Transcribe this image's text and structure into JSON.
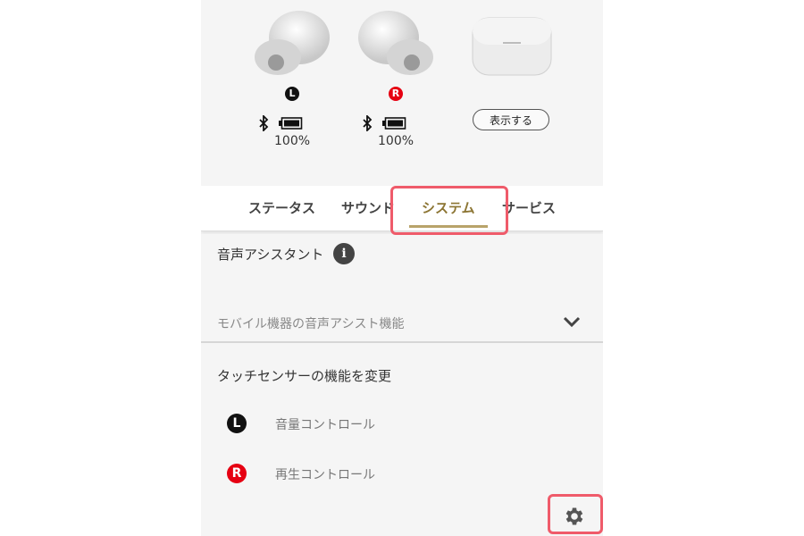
{
  "devices": {
    "left": {
      "side": "L",
      "battery": "100%"
    },
    "right": {
      "side": "R",
      "battery": "100%"
    },
    "case": {
      "show_button": "表示する"
    }
  },
  "tabs": [
    {
      "label": "ステータス"
    },
    {
      "label": "サウンド"
    },
    {
      "label": "システム",
      "active": true
    },
    {
      "label": "サービス"
    }
  ],
  "voice_assistant": {
    "title": "音声アシスタント",
    "info_icon": "info-icon",
    "dropdown_value": "モバイル機器の音声アシスト機能"
  },
  "touch_sensor": {
    "title": "タッチセンサーの機能を変更",
    "rows": [
      {
        "side": "L",
        "label": "音量コントロール"
      },
      {
        "side": "R",
        "label": "再生コントロール"
      }
    ]
  },
  "settings_icon": "gear-icon",
  "colors": {
    "accent_gold": "#8c7533",
    "highlight": "#ef5b6a",
    "right_red": "#e60012",
    "left_black": "#111111"
  }
}
